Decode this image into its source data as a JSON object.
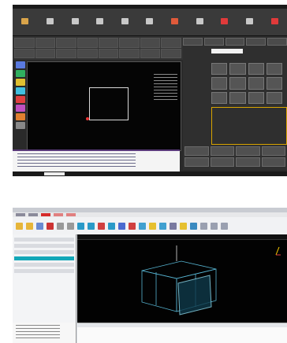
{
  "screenshot_1": {
    "toolbar_icons": [
      "open-icon",
      "save-icon",
      "draw-icon",
      "edit-icon",
      "layer-icon",
      "tool-icon",
      "cut-icon",
      "sim-icon",
      "gear-icon",
      "info-icon",
      "help-icon"
    ],
    "colors": {
      "background": "#2a2a2a",
      "canvas": "#050505",
      "accent_red": "#e33333",
      "accent_purple": "#5a3a7a",
      "accent_gold": "#d9a400"
    }
  },
  "screenshot_2": {
    "colors": {
      "background": "#d9dde3",
      "viewport": "#020202",
      "selection": "#13a7b8",
      "active_menu": "#d52b2b",
      "model_wire": "#5fc6e6"
    }
  }
}
